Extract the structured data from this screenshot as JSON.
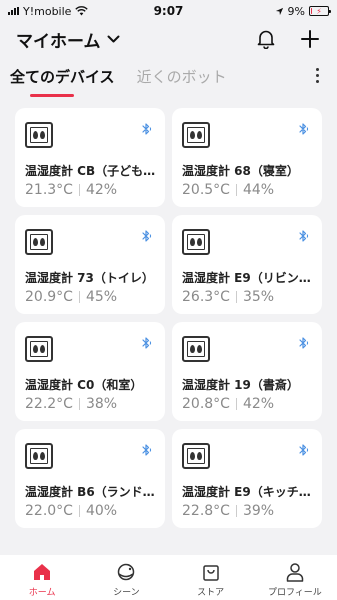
{
  "status": {
    "carrier": "Y!mobile",
    "time": "9:07",
    "battery": "9%",
    "battery_level": 0.09
  },
  "header": {
    "title": "マイホーム"
  },
  "tabs": [
    {
      "label": "全てのデバイス"
    },
    {
      "label": "近くのボット"
    }
  ],
  "devices": [
    {
      "name": "温湿度計 CB（子ども…",
      "temp": "21.3°C",
      "humidity": "42%"
    },
    {
      "name": "温湿度計 68（寝室）",
      "temp": "20.5°C",
      "humidity": "44%"
    },
    {
      "name": "温湿度計 73（トイレ）",
      "temp": "20.9°C",
      "humidity": "45%"
    },
    {
      "name": "温湿度計 E9（リビン…",
      "temp": "26.3°C",
      "humidity": "35%"
    },
    {
      "name": "温湿度計 C0（和室）",
      "temp": "22.2°C",
      "humidity": "38%"
    },
    {
      "name": "温湿度計 19（書斎）",
      "temp": "20.8°C",
      "humidity": "42%"
    },
    {
      "name": "温湿度計 B6（ランド…",
      "temp": "22.0°C",
      "humidity": "40%"
    },
    {
      "name": "温湿度計 E9（キッチ…",
      "temp": "22.8°C",
      "humidity": "39%"
    }
  ],
  "nav": [
    {
      "label": "ホーム"
    },
    {
      "label": "シーン"
    },
    {
      "label": "ストア"
    },
    {
      "label": "プロフィール"
    }
  ],
  "colors": {
    "accent": "#e9314a",
    "bluetooth": "#4a90e2"
  }
}
